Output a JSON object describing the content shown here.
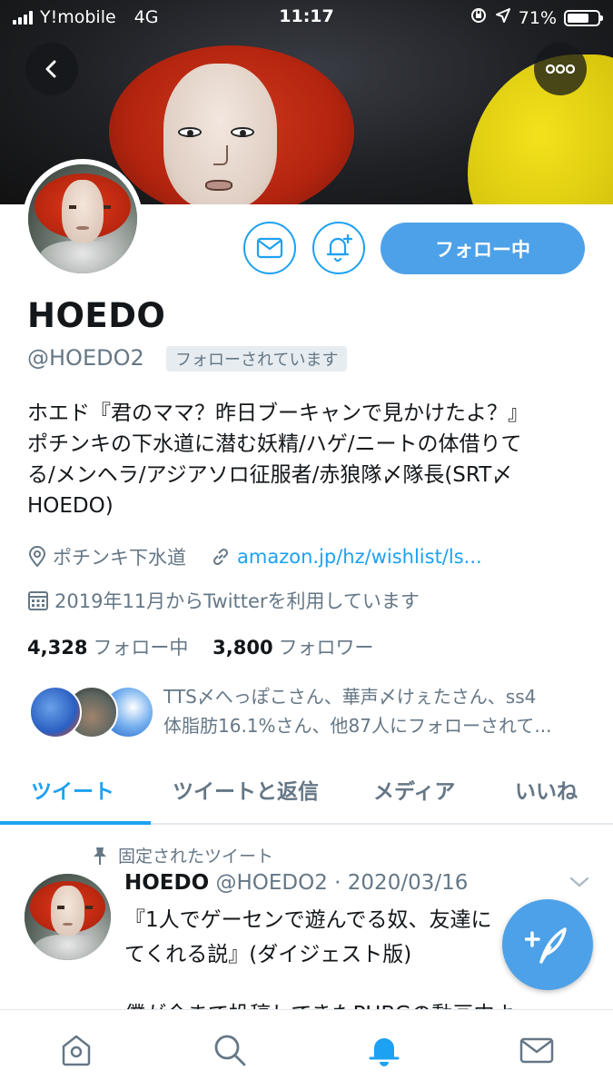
{
  "status_bar": {
    "carrier": "Y!mobile",
    "network": "4G",
    "time": "11:17",
    "battery_percent": "71%",
    "battery_level": 0.71
  },
  "header": {
    "back_icon": "chevron-left-icon",
    "more_icon": "more-dots-icon"
  },
  "profile": {
    "name": "HOEDO",
    "handle": "@HOEDO2",
    "follows_you_badge": "フォローされています",
    "follow_button_label": "フォロー中",
    "bio": "ホエド『君のママ？昨日ブーキャンで見かけたよ？』\nポチンキの下水道に潜む妖精/ハゲ/ニートの体借りて\nる/メンヘラ/アジアソロ征服者/赤狼隊〆隊長(SRT〆\nHOEDO)",
    "location": "ポチンキ下水道",
    "website": "amazon.jp/hz/wishlist/ls...",
    "joined": "2019年11月からTwitterを利用しています",
    "following_count": "4,328",
    "following_label": "フォロー中",
    "followers_count": "3,800",
    "followers_label": "フォロワー",
    "mutual_line1": "TTS〆へっぽこさん、華声〆けぇたさん、ss4",
    "mutual_line2": "体脂肪16.1%さん、他87人にフォローされて..."
  },
  "tabs": [
    {
      "label": "ツイート",
      "active": true
    },
    {
      "label": "ツイートと返信",
      "active": false
    },
    {
      "label": "メディア",
      "active": false
    },
    {
      "label": "いいね",
      "active": false
    }
  ],
  "pinned_tweet": {
    "pinned_label": "固定されたツイート",
    "author": "HOEDO",
    "handle_date": "@HOEDO2 · 2020/03/16",
    "text": "『1人でゲーセンで遊んでる奴、友達に\nてくれる説』(ダイジェスト版)",
    "text_cut": "僕が今まで投稿してきたPUBGの動画中よ"
  },
  "bottom_nav": [
    "home-icon",
    "search-icon",
    "notifications-bell-icon",
    "messages-envelope-icon"
  ],
  "colors": {
    "accent": "#1da1f2",
    "button_fill": "#4da1e8",
    "muted_text": "#657786"
  }
}
